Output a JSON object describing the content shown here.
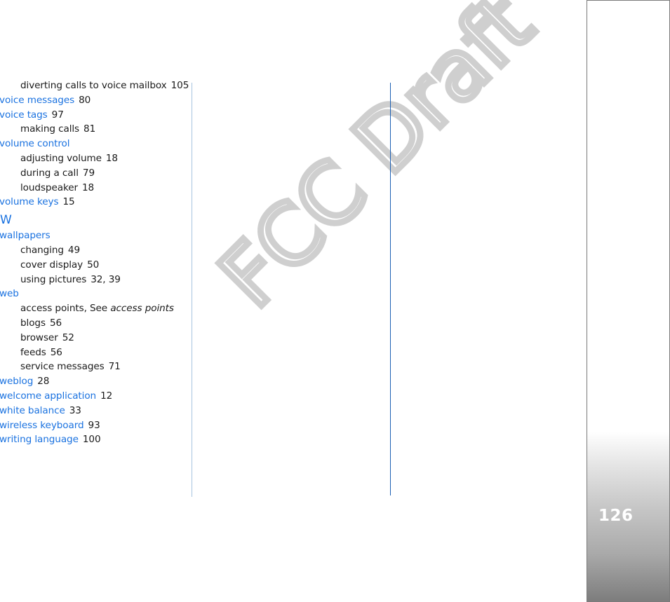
{
  "watermark": "FCC Draft",
  "page_number": "126",
  "colors": {
    "term": "#1a72e0",
    "text": "#1a1a1a",
    "rule_light": "#a8c4e0",
    "rule_dark": "#1c5fb3"
  },
  "index": {
    "entries": [
      {
        "type": "sub",
        "term": "diverting calls to voice mailbox",
        "pages": "105"
      },
      {
        "type": "main",
        "term": "voice messages",
        "pages": "80"
      },
      {
        "type": "main",
        "term": "voice tags",
        "pages": "97"
      },
      {
        "type": "sub",
        "term": "making calls",
        "pages": "81"
      },
      {
        "type": "main",
        "term": "volume control",
        "pages": ""
      },
      {
        "type": "sub",
        "term": "adjusting volume",
        "pages": "18"
      },
      {
        "type": "sub",
        "term": "during a call",
        "pages": "79"
      },
      {
        "type": "sub",
        "term": "loudspeaker",
        "pages": "18"
      },
      {
        "type": "main",
        "term": "volume keys",
        "pages": "15"
      },
      {
        "type": "letter",
        "term": "W"
      },
      {
        "type": "main",
        "term": "wallpapers",
        "pages": ""
      },
      {
        "type": "sub",
        "term": "changing",
        "pages": "49"
      },
      {
        "type": "sub",
        "term": "cover display",
        "pages": "50"
      },
      {
        "type": "sub",
        "term": "using pictures",
        "pages": "32, 39"
      },
      {
        "type": "main",
        "term": "web",
        "pages": ""
      },
      {
        "type": "sub",
        "term": "access points, See",
        "see": "access points"
      },
      {
        "type": "sub",
        "term": "blogs",
        "pages": "56"
      },
      {
        "type": "sub",
        "term": "browser",
        "pages": "52"
      },
      {
        "type": "sub",
        "term": "feeds",
        "pages": "56"
      },
      {
        "type": "sub",
        "term": "service messages",
        "pages": "71"
      },
      {
        "type": "main",
        "term": "weblog",
        "pages": "28"
      },
      {
        "type": "main",
        "term": "welcome application",
        "pages": "12"
      },
      {
        "type": "main",
        "term": "white balance",
        "pages": "33"
      },
      {
        "type": "main",
        "term": "wireless keyboard",
        "pages": "93"
      },
      {
        "type": "main",
        "term": "writing language",
        "pages": "100"
      }
    ]
  }
}
